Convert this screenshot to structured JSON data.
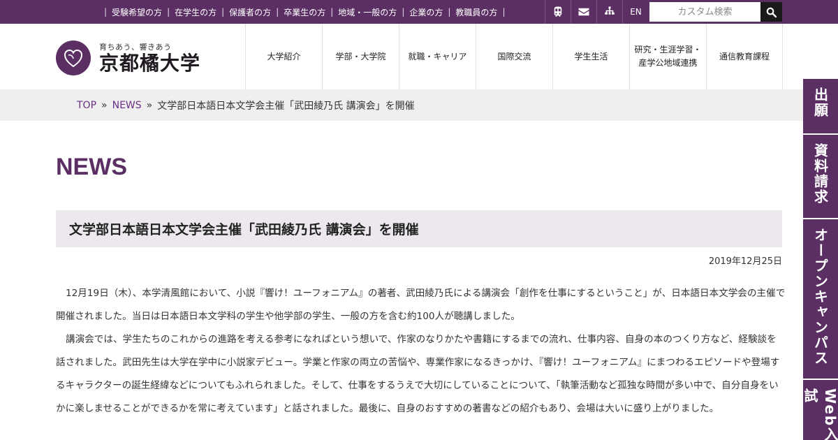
{
  "topbar": {
    "audience_links": [
      "受験希望の方",
      "在学生の方",
      "保護者の方",
      "卒業生の方",
      "地域・一般の方",
      "企業の方",
      "教職員の方"
    ],
    "separator": "|",
    "en_label": "EN",
    "search_placeholder": "カスタム検索",
    "icons": [
      "train-icon",
      "mail-icon",
      "sitemap-icon",
      "search-icon"
    ]
  },
  "header": {
    "logo_tagline": "育ちあう、響きあう",
    "logo_name": "京都橘大学",
    "nav": [
      "大学紹介",
      "学部・大学院",
      "就職・キャリア",
      "国際交流",
      "学生生活",
      "研究・生涯学習・\n産学公地域連携",
      "通信教育課程"
    ]
  },
  "breadcrumb": {
    "top": "TOP",
    "news": "NEWS",
    "arrow": "»",
    "current": "文学部日本語日本文学会主催「武田綾乃氏 講演会」を開催"
  },
  "main": {
    "page_title": "NEWS",
    "article_title": "文学部日本語日本文学会主催「武田綾乃氏 講演会」を開催",
    "date": "2019年12月25日",
    "paragraphs": [
      "12月19日（木）、本学清風館において、小説『響け！ユーフォニアム』の著者、武田綾乃氏による講演会「創作を仕事にするということ」が、日本語日本文学会の主催で開催されました。当日は日本語日本文学科の学生や他学部の学生、一般の方を含む約100人が聴講しました。",
      "講演会では、学生たちのこれからの進路を考える参考になればという想いで、作家のなりかたや書籍にするまでの流れ、仕事内容、自身の本のつくり方など、経験談を話されました。武田先生は大学在学中に小説家デビュー。学業と作家の両立の苦悩や、専業作家になるきっかけ、『響け！ユーフォニアム』にまつわるエピソードや登場するキャラクターの誕生経緯などについてもふれられました。そして、仕事をするうえで大切にしていることについて、「執筆活動など孤独な時間が多い中で、自分自身をいかに楽しませることができるかを常に考えています」と話されました。最後に、自身のおすすめの著書などの紹介もあり、会場は大いに盛り上がりました。"
    ]
  },
  "side_tabs": [
    "出願",
    "資料請求",
    "オープンキャンパス",
    "Web入試"
  ],
  "colors": {
    "brand": "#5b2f63",
    "link": "#6a2f84",
    "title_bg": "#ece8ee",
    "crumb_bg": "#efefef"
  }
}
